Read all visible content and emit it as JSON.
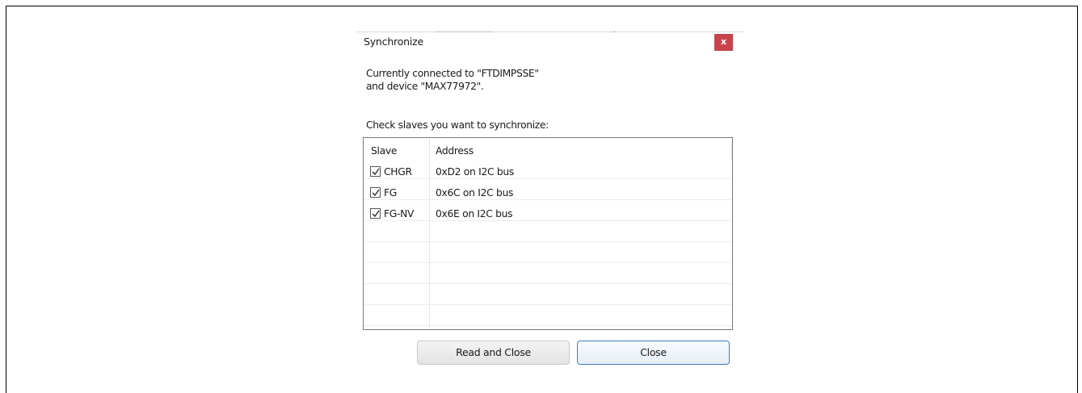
{
  "dialog": {
    "title": "Synchronize",
    "close_glyph": "x"
  },
  "info": {
    "line1": "Currently connected to \"FTDIMPSSE\"",
    "line2": "and device \"MAX77972\"."
  },
  "instruction": "Check slaves you want to synchronize:",
  "table": {
    "columns": [
      "Slave",
      "Address"
    ],
    "rows": [
      {
        "slave": "CHGR",
        "address": "0xD2 on I2C bus",
        "checked": true
      },
      {
        "slave": "FG",
        "address": "0x6C on I2C bus",
        "checked": true
      },
      {
        "slave": "FG-NV",
        "address": "0x6E on I2C bus",
        "checked": true
      }
    ]
  },
  "buttons": {
    "read_and_close": "Read and Close",
    "close": "Close"
  },
  "colors": {
    "close_button_bg": "#c8444c",
    "focus_border": "#3b7ec1"
  },
  "icons": {
    "close": "close-icon",
    "checkbox": "check-icon"
  }
}
